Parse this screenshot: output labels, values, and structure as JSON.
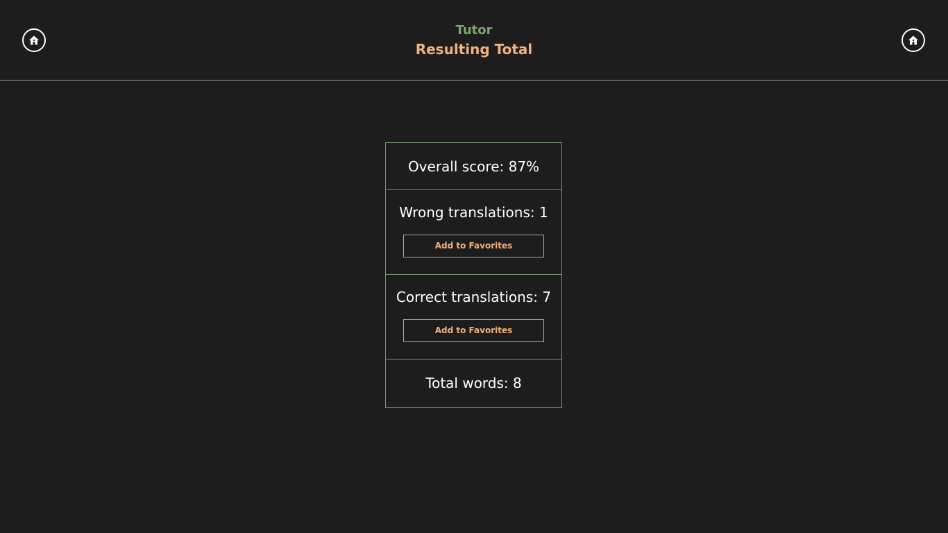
{
  "header": {
    "app_title": "Tutor",
    "page_title": "Resulting Total",
    "home_icon_left": "home-icon",
    "home_icon_right": "home-icon"
  },
  "results": {
    "overall_score": "Overall score: 87%",
    "wrong_translations": "Wrong translations: 1",
    "wrong_add_favorites_label": "Add to Favorites",
    "correct_translations": "Correct translations: 7",
    "correct_add_favorites_label": "Add to Favorites",
    "total_words": "Total words: 8"
  },
  "colors": {
    "background": "#1d1d1d",
    "app_title": "#7fa672",
    "page_title": "#f2b27a",
    "border": "#6f9a63",
    "button_text": "#f2b27a"
  }
}
